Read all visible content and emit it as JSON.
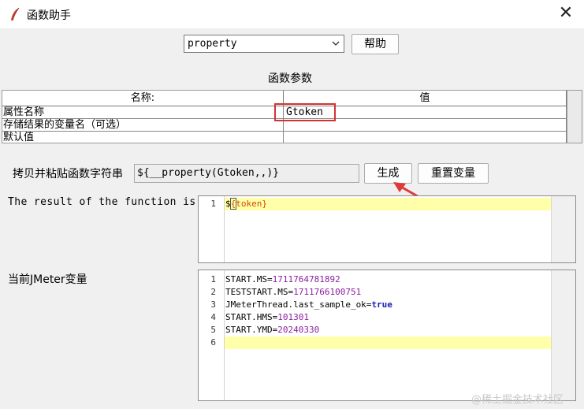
{
  "window": {
    "title": "函数助手",
    "close_glyph": "✕"
  },
  "function_select": {
    "value": "property"
  },
  "help_button": "帮助",
  "params": {
    "section_title": "函数参数",
    "columns": [
      "名称:",
      "值"
    ],
    "rows": [
      {
        "name": "属性名称",
        "value": "Gtoken"
      },
      {
        "name": "存储结果的变量名（可选）",
        "value": ""
      },
      {
        "name": "默认值",
        "value": ""
      }
    ]
  },
  "copy_row": {
    "label": "拷贝并粘贴函数字符串",
    "value": "${__property(Gtoken,,)}",
    "generate_button": "生成",
    "reset_button": "重置变量"
  },
  "result": {
    "label": "The result of the function is",
    "lines": [
      {
        "num": "1",
        "prefix": "$",
        "cursor": "{",
        "text": "token",
        "suffix": "}"
      }
    ]
  },
  "jmeter_vars": {
    "label": "当前JMeter变量",
    "lines": [
      {
        "num": "1",
        "key": "START.MS=",
        "val": "1711764781892",
        "type": "num"
      },
      {
        "num": "2",
        "key": "TESTSTART.MS=",
        "val": "1711766100751",
        "type": "num"
      },
      {
        "num": "3",
        "key": "JMeterThread.last_sample_ok=",
        "val": "true",
        "type": "kw"
      },
      {
        "num": "4",
        "key": "START.HMS=",
        "val": "101301",
        "type": "num"
      },
      {
        "num": "5",
        "key": "START.YMD=",
        "val": "20240330",
        "type": "num"
      },
      {
        "num": "6",
        "key": "",
        "val": "",
        "type": "num"
      }
    ]
  },
  "watermark": "@稀土掘金技术社区",
  "colors": {
    "highlight_box": "#d33333",
    "arrow": "#e0393a",
    "current_line": "#ffffaa"
  }
}
